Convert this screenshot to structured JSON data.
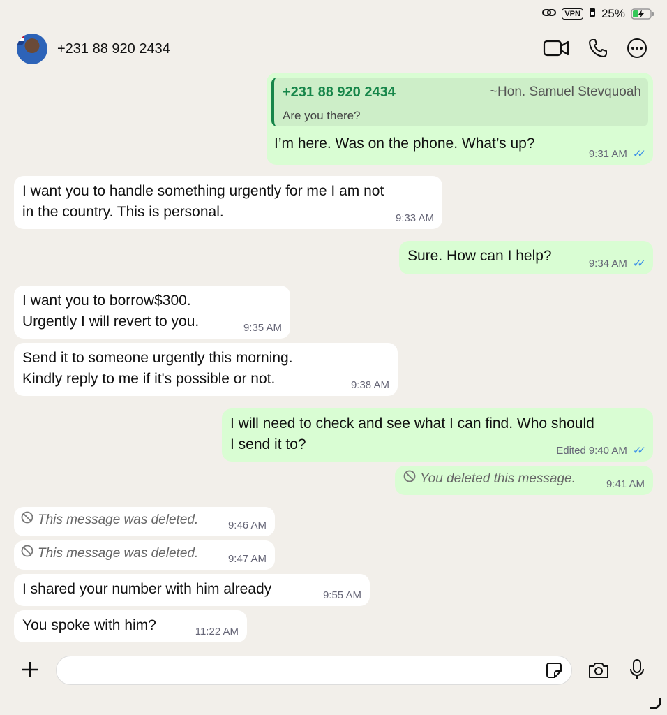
{
  "status": {
    "vpn": "VPN",
    "battery": "25%"
  },
  "header": {
    "contact": "+231 88 920 2434"
  },
  "messages": [
    {
      "dir": "out",
      "quote": {
        "name": "+231 88 920 2434",
        "alias": "~Hon. Samuel Stevquoah",
        "text": "Are you there?"
      },
      "text": "I’m here. Was on the phone. What’s up?",
      "time": "9:31 AM"
    },
    {
      "dir": "in",
      "text": "I want you to handle something urgently for me I am not\nin the country. This is personal.",
      "time": "9:33 AM"
    },
    {
      "dir": "out",
      "text": "Sure. How can I help?",
      "time": "9:34 AM"
    },
    {
      "dir": "in",
      "text": "I want you to borrow$300.\nUrgently I will revert to you.",
      "time": "9:35 AM"
    },
    {
      "dir": "in",
      "text": "Send it to someone urgently this morning.\nKindly reply to me if it's possible or not.",
      "time": "9:38 AM"
    },
    {
      "dir": "out",
      "text": "I will need to check and see what I can find. Who should\nI send it to?",
      "edited": "Edited",
      "time": "9:40 AM"
    },
    {
      "dir": "out",
      "deleted": "You deleted this message.",
      "time": "9:41 AM"
    },
    {
      "dir": "in",
      "deleted": "This message was deleted.",
      "time": "9:46 AM"
    },
    {
      "dir": "in",
      "deleted": "This message was deleted.",
      "time": "9:47 AM"
    },
    {
      "dir": "in",
      "text": "I shared your number with him already",
      "time": "9:55 AM"
    },
    {
      "dir": "in",
      "text": "You spoke with him?",
      "time": "11:22 AM"
    }
  ],
  "input": {
    "placeholder": ""
  }
}
